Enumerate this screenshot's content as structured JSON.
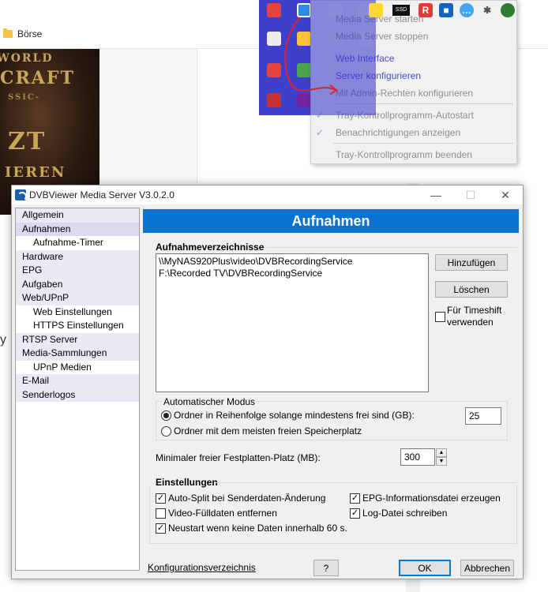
{
  "browser": {
    "bookmark": "Börse"
  },
  "background_art": {
    "line1": "WORLD",
    "line2": "CRAFT",
    "line3": "SSIC-",
    "line4": "ZT",
    "line5": "IEREN",
    "edge_letter": "y"
  },
  "tray_menu": {
    "items": [
      {
        "label": "Media Server starten"
      },
      {
        "label": "Media Server stoppen"
      },
      {
        "label": "Web Interface"
      },
      {
        "label": "Server konfigurieren"
      },
      {
        "label": "Mit Admin-Rechten konfigurieren"
      },
      {
        "label": "Tray-Kontrollprogramm-Autostart",
        "checked": true
      },
      {
        "label": "Benachrichtigungen anzeigen",
        "checked": true
      },
      {
        "label": "Tray-Kontrollprogramm beenden"
      }
    ],
    "tray_badge": "SSD"
  },
  "dialog": {
    "title": "DVBViewer Media Server V3.0.2.0",
    "nav": [
      {
        "label": "Allgemein",
        "level": "top"
      },
      {
        "label": "Aufnahmen",
        "level": "top",
        "selected": true
      },
      {
        "label": "Aufnahme-Timer",
        "level": "sub"
      },
      {
        "label": "Hardware",
        "level": "top"
      },
      {
        "label": "EPG",
        "level": "top"
      },
      {
        "label": "Aufgaben",
        "level": "top"
      },
      {
        "label": "Web/UPnP",
        "level": "top"
      },
      {
        "label": "Web Einstellungen",
        "level": "sub"
      },
      {
        "label": "HTTPS Einstellungen",
        "level": "sub"
      },
      {
        "label": "RTSP Server",
        "level": "top"
      },
      {
        "label": "Media-Sammlungen",
        "level": "top"
      },
      {
        "label": "UPnP Medien",
        "level": "sub"
      },
      {
        "label": "E-Mail",
        "level": "top"
      },
      {
        "label": "Senderlogos",
        "level": "top"
      }
    ],
    "header": "Aufnahmen",
    "recording_dirs": {
      "label": "Aufnahmeverzeichnisse",
      "items": [
        "\\\\MyNAS920Plus\\video\\DVBRecordingService",
        "F:\\Recorded TV\\DVBRecordingService"
      ],
      "add_button": "Hinzufügen",
      "delete_button": "Löschen",
      "timeshift_label_1": "Für Timeshift",
      "timeshift_label_2": "verwenden",
      "timeshift_checked": false
    },
    "auto_mode": {
      "label": "Automatischer Modus",
      "option1": "Ordner in Reihenfolge solange mindestens frei sind (GB):",
      "option1_value": "25",
      "option2": "Ordner mit dem meisten freien Speicherplatz",
      "selected": 1
    },
    "min_space": {
      "label": "Minimaler freier Festplatten-Platz (MB):",
      "value": "300"
    },
    "settings": {
      "label": "Einstellungen",
      "auto_split": "Auto-Split bei Senderdaten-Änderung",
      "video_fill": "Video-Fülldaten entfernen",
      "restart": "Neustart wenn keine Daten innerhalb 60 s.",
      "epg_file": "EPG-Informationsdatei erzeugen",
      "log_file": "Log-Datei schreiben",
      "checked": {
        "auto_split": true,
        "video_fill": false,
        "restart": true,
        "epg_file": true,
        "log_file": true
      }
    },
    "footer": {
      "config_link": "Konfigurationsverzeichnis",
      "help": "?",
      "ok": "OK",
      "cancel": "Abbrechen"
    },
    "window_controls": {
      "minimize": "—",
      "maximize": "☐",
      "close": "✕"
    }
  }
}
